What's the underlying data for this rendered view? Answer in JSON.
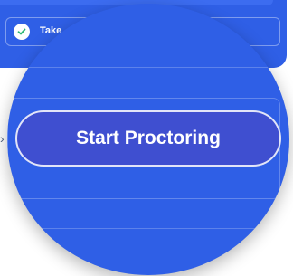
{
  "task": {
    "label": "Take",
    "check_icon": "check-circle-icon"
  },
  "magnifier": {
    "button_label": "Start Proctoring"
  },
  "colors": {
    "panel_blue": "#2f5fe6",
    "button_blue": "#3f4fd0",
    "check_green": "#2bb673"
  }
}
